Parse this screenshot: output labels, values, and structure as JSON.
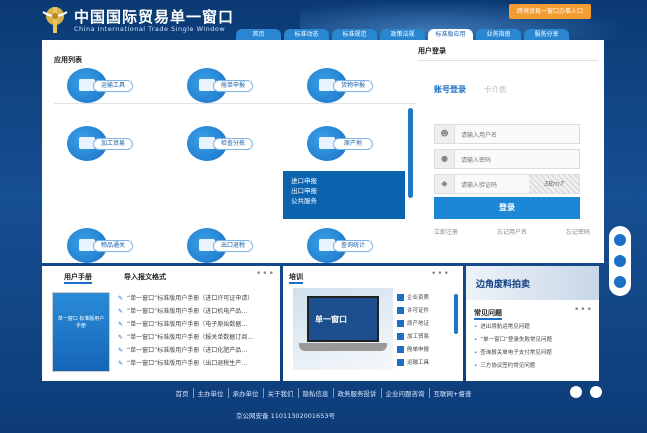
{
  "header": {
    "title_cn": "中国国际贸易单一窗口",
    "title_en": "China International Trade Single Window",
    "top_link": "跨境贸易一窗口办事入口",
    "nav": [
      "首页",
      "标准动态",
      "标准规范",
      "政策法规",
      "标准版应用",
      "业务指南",
      "服务分享"
    ],
    "active_nav": 4
  },
  "apps": {
    "title": "应用列表",
    "items": [
      "运输工具",
      "舱单申报",
      "货物申报",
      "加工贸易",
      "检查分拣",
      "原产地",
      "物品通关",
      "出口退税",
      "查询统计"
    ],
    "popup": [
      "进口申报",
      "出口申报",
      "公共服务"
    ]
  },
  "login": {
    "title": "用户登录",
    "tab_account": "账号登录",
    "tab_cert": "卡介质",
    "username_placeholder": "请输入用户名",
    "password_placeholder": "请输入密码",
    "captcha_placeholder": "请输入验证码",
    "captcha_text": "3Bm7",
    "submit": "登录",
    "links": [
      "立即注册",
      "忘记用户名",
      "忘记密码"
    ]
  },
  "manual": {
    "tab1": "用户手册",
    "tab2": "导入报文格式",
    "book": "单一窗口 标准版用户手册",
    "items": [
      "“单一窗口”标准版用户手册（进口许可证申请）",
      "“单一窗口”标准版用户手册（进口机电产品…",
      "“单一窗口”标准版用户手册（电子原始数据…",
      "“单一窗口”标准版用户手册（报关单数据订阅…",
      "“单一窗口”标准版用户手册（进口化肥产品…",
      "“单一窗口”标准版用户手册（出口退税生产…"
    ]
  },
  "training": {
    "title": "培训",
    "screen_text": "单一窗口",
    "items": [
      "企业资质",
      "许可证件",
      "原产地证",
      "加工贸易",
      "舱单申报",
      "运输工具"
    ]
  },
  "faq": {
    "banner": "边角废料拍卖",
    "title": "常见问题",
    "items": [
      "进出境航运常见问题",
      "“单一窗口”登录失败常见问题",
      "查询报关单电子支付常见问题",
      "三方协议签约常见问题"
    ]
  },
  "footer": {
    "links": [
      "首页",
      "主办单位",
      "承办单位",
      "关于我们",
      "隐私信息",
      "政务服务投诉",
      "企业问题咨询",
      "互联网+督查"
    ],
    "icp": "京公网安备 11011302001653号"
  }
}
